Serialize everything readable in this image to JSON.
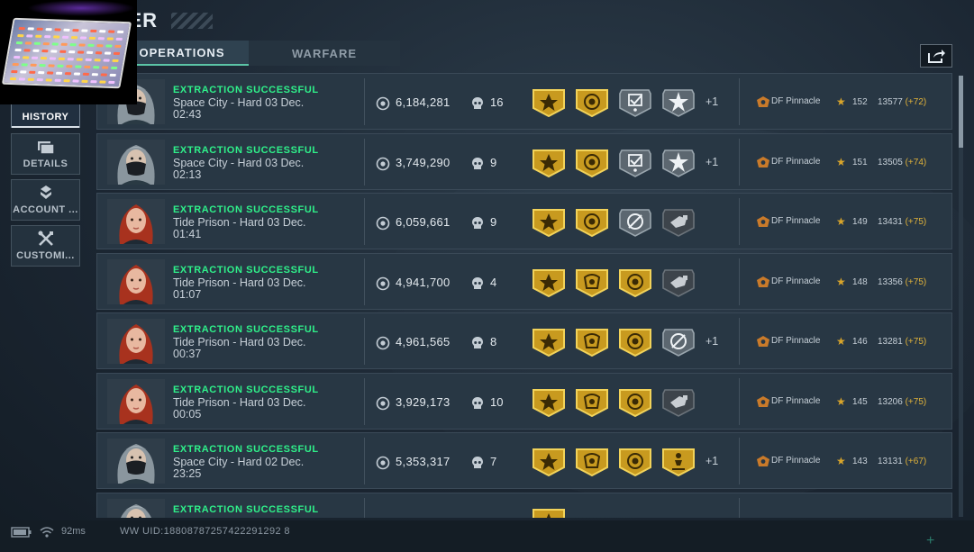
{
  "header": {
    "title": "TER"
  },
  "tabs": [
    {
      "label": "OPERATIONS",
      "active": true
    },
    {
      "label": "WARFARE",
      "active": false
    }
  ],
  "sidebar": {
    "items": [
      {
        "label": "HISTORY",
        "icon": "clock-icon",
        "active": true
      },
      {
        "label": "DETAILS",
        "icon": "folders-icon",
        "active": false
      },
      {
        "label": "ACCOUNT ...",
        "icon": "account-icon",
        "active": false
      },
      {
        "label": "CUSTOMI...",
        "icon": "wrench-icon",
        "active": false
      }
    ]
  },
  "colors": {
    "success": "#2ff08a",
    "accent": "#5bc4a6",
    "gold": "#d9a52b"
  },
  "rows": [
    {
      "status": "EXTRACTION SUCCESSFUL",
      "map": "Space City - Hard",
      "date": "03 Dec.",
      "time": "02:43",
      "value": "6,184,281",
      "kills": "16",
      "avatar": "masked",
      "badges": [
        "gold-star",
        "gold-coin",
        "silver-check",
        "silver-star"
      ],
      "more": "+1",
      "team": "DF Pinnacle",
      "level": "152",
      "score": "13577",
      "delta": "(+72)"
    },
    {
      "status": "EXTRACTION SUCCESSFUL",
      "map": "Space City - Hard",
      "date": "03 Dec.",
      "time": "02:13",
      "value": "3,749,290",
      "kills": "9",
      "avatar": "masked",
      "badges": [
        "gold-star",
        "gold-coin",
        "silver-check",
        "silver-star"
      ],
      "more": "+1",
      "team": "DF Pinnacle",
      "level": "151",
      "score": "13505",
      "delta": "(+74)"
    },
    {
      "status": "EXTRACTION SUCCESSFUL",
      "map": "Tide Prison - Hard",
      "date": "03 Dec.",
      "time": "01:41",
      "value": "6,059,661",
      "kills": "9",
      "avatar": "redhead",
      "badges": [
        "gold-star",
        "gold-coin",
        "silver-cycle",
        "dark-hand"
      ],
      "more": "",
      "team": "DF Pinnacle",
      "level": "149",
      "score": "13431",
      "delta": "(+75)"
    },
    {
      "status": "EXTRACTION SUCCESSFUL",
      "map": "Tide Prison - Hard",
      "date": "03 Dec.",
      "time": "01:07",
      "value": "4,941,700",
      "kills": "4",
      "avatar": "redhead",
      "badges": [
        "gold-star",
        "gold-crest",
        "gold-coin",
        "dark-hand"
      ],
      "more": "",
      "team": "DF Pinnacle",
      "level": "148",
      "score": "13356",
      "delta": "(+75)"
    },
    {
      "status": "EXTRACTION SUCCESSFUL",
      "map": "Tide Prison - Hard",
      "date": "03 Dec.",
      "time": "00:37",
      "value": "4,961,565",
      "kills": "8",
      "avatar": "redhead",
      "badges": [
        "gold-star",
        "gold-crest",
        "gold-coin",
        "silver-cycle"
      ],
      "more": "+1",
      "team": "DF Pinnacle",
      "level": "146",
      "score": "13281",
      "delta": "(+75)"
    },
    {
      "status": "EXTRACTION SUCCESSFUL",
      "map": "Tide Prison - Hard",
      "date": "03 Dec.",
      "time": "00:05",
      "value": "3,929,173",
      "kills": "10",
      "avatar": "redhead",
      "badges": [
        "gold-star",
        "gold-crest",
        "gold-coin",
        "dark-hand"
      ],
      "more": "",
      "team": "DF Pinnacle",
      "level": "145",
      "score": "13206",
      "delta": "(+75)"
    },
    {
      "status": "EXTRACTION SUCCESSFUL",
      "map": "Space City - Hard",
      "date": "02 Dec.",
      "time": "23:25",
      "value": "5,353,317",
      "kills": "7",
      "avatar": "masked",
      "badges": [
        "gold-star",
        "gold-crest",
        "gold-coin",
        "gold-figure"
      ],
      "more": "+1",
      "team": "DF Pinnacle",
      "level": "143",
      "score": "13131",
      "delta": "(+67)"
    },
    {
      "status": "EXTRACTION SUCCESSFUL",
      "map": "",
      "date": "",
      "time": "",
      "value": "",
      "kills": "",
      "avatar": "masked",
      "badges": [
        "gold-star"
      ],
      "more": "",
      "team": "",
      "level": "",
      "score": "",
      "delta": ""
    }
  ],
  "footer": {
    "ping": "92ms",
    "uid": "WW UID:18808787257422291292 8"
  }
}
